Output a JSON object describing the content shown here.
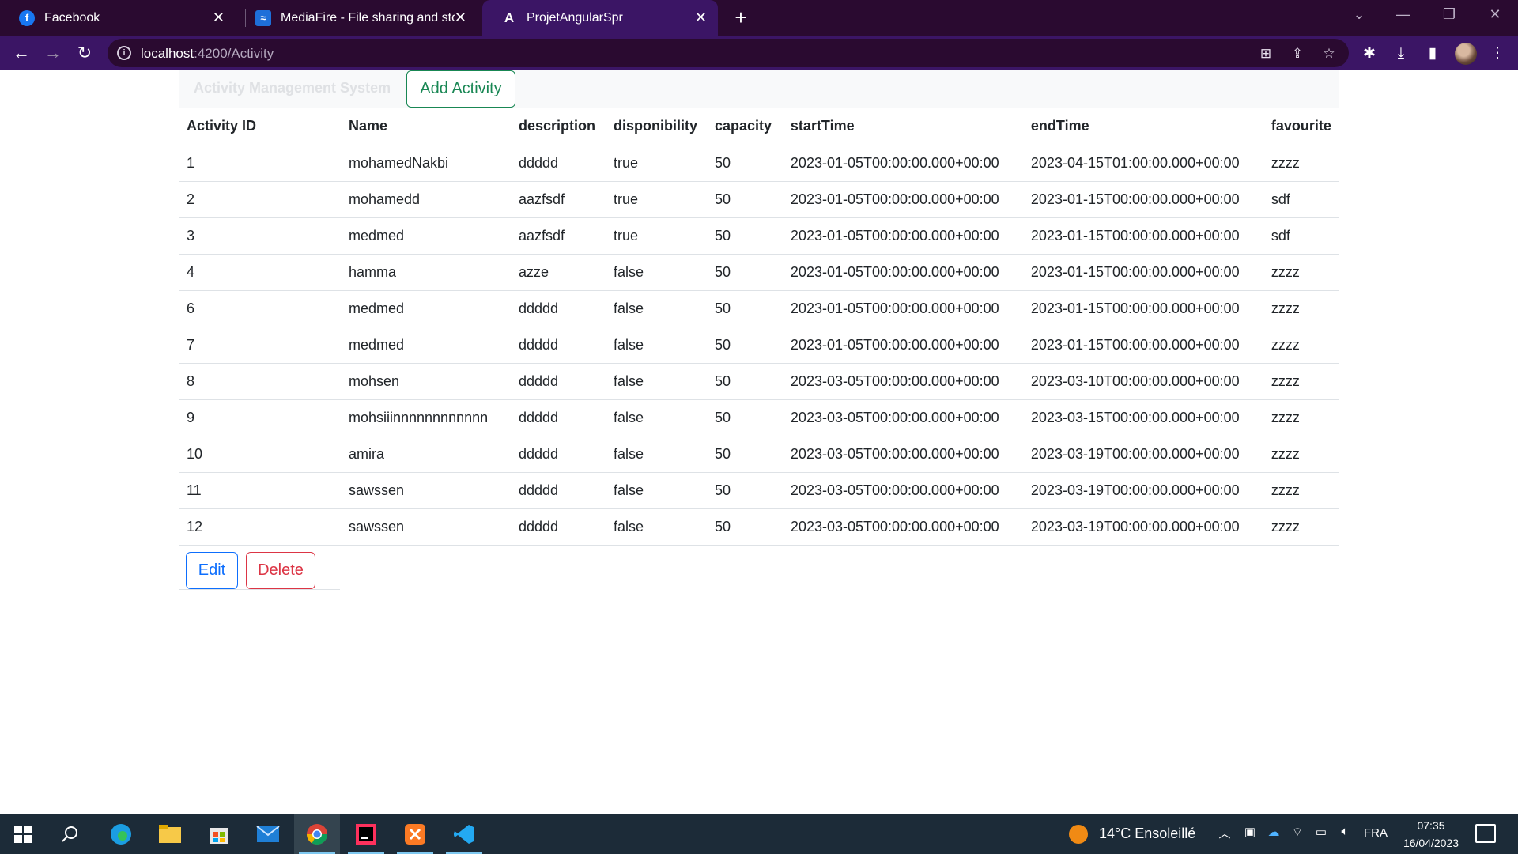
{
  "browser": {
    "tabs": [
      {
        "title": "Facebook",
        "icon": "facebook-icon"
      },
      {
        "title": "MediaFire - File sharing and stora",
        "icon": "mediafire-icon"
      },
      {
        "title": "ProjetAngularSpr",
        "icon": "angular-icon"
      }
    ],
    "url_host": "localhost",
    "url_rest": ":4200/Activity",
    "theme_color": "#3b1565"
  },
  "navbar": {
    "brand": "Activity Management System",
    "add_button": "Add Activity"
  },
  "table": {
    "headers": [
      "Activity ID",
      "Name",
      "description",
      "disponibility",
      "capacity",
      "startTime",
      "endTime",
      "favourite"
    ],
    "rows": [
      [
        "1",
        "mohamedNakbi",
        "ddddd",
        "true",
        "50",
        "2023-01-05T00:00:00.000+00:00",
        "2023-04-15T01:00:00.000+00:00",
        "zzzz"
      ],
      [
        "2",
        "mohamedd",
        "aazfsdf",
        "true",
        "50",
        "2023-01-05T00:00:00.000+00:00",
        "2023-01-15T00:00:00.000+00:00",
        "sdf"
      ],
      [
        "3",
        "medmed",
        "aazfsdf",
        "true",
        "50",
        "2023-01-05T00:00:00.000+00:00",
        "2023-01-15T00:00:00.000+00:00",
        "sdf"
      ],
      [
        "4",
        "hamma",
        "azze",
        "false",
        "50",
        "2023-01-05T00:00:00.000+00:00",
        "2023-01-15T00:00:00.000+00:00",
        "zzzz"
      ],
      [
        "6",
        "medmed",
        "ddddd",
        "false",
        "50",
        "2023-01-05T00:00:00.000+00:00",
        "2023-01-15T00:00:00.000+00:00",
        "zzzz"
      ],
      [
        "7",
        "medmed",
        "ddddd",
        "false",
        "50",
        "2023-01-05T00:00:00.000+00:00",
        "2023-01-15T00:00:00.000+00:00",
        "zzzz"
      ],
      [
        "8",
        "mohsen",
        "ddddd",
        "false",
        "50",
        "2023-03-05T00:00:00.000+00:00",
        "2023-03-10T00:00:00.000+00:00",
        "zzzz"
      ],
      [
        "9",
        "mohsiiinnnnnnnnnnnn",
        "ddddd",
        "false",
        "50",
        "2023-03-05T00:00:00.000+00:00",
        "2023-03-15T00:00:00.000+00:00",
        "zzzz"
      ],
      [
        "10",
        "amira",
        "ddddd",
        "false",
        "50",
        "2023-03-05T00:00:00.000+00:00",
        "2023-03-19T00:00:00.000+00:00",
        "zzzz"
      ],
      [
        "11",
        "sawssen",
        "ddddd",
        "false",
        "50",
        "2023-03-05T00:00:00.000+00:00",
        "2023-03-19T00:00:00.000+00:00",
        "zzzz"
      ],
      [
        "12",
        "sawssen",
        "ddddd",
        "false",
        "50",
        "2023-03-05T00:00:00.000+00:00",
        "2023-03-19T00:00:00.000+00:00",
        "zzzz"
      ]
    ]
  },
  "actions": {
    "edit_label": "Edit",
    "delete_label": "Delete"
  },
  "taskbar": {
    "weather": "14°C  Ensoleillé",
    "language": "FRA",
    "time": "07:35",
    "date": "16/04/2023",
    "apps": [
      "start-icon",
      "search-icon",
      "edge-icon",
      "file-explorer-icon",
      "store-icon",
      "mail-icon",
      "chrome-icon",
      "intellij-icon",
      "xampp-icon",
      "vscode-icon"
    ]
  }
}
